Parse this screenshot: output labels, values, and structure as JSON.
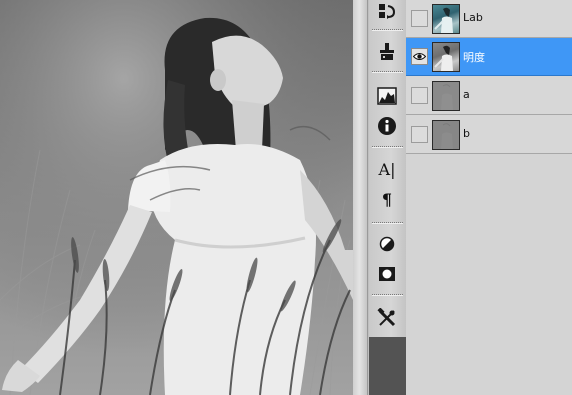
{
  "colors": {
    "panel_bg": "#d7d7d7",
    "selected_row": "#3f97f6",
    "toolstrip_bg": "#535353"
  },
  "canvas": {
    "image_subject": "grayscale-photo-woman-in-grass-field"
  },
  "toolbar": {
    "tools": [
      {
        "name": "history-icon"
      },
      {
        "name": "brush-presets-icon"
      },
      {
        "name": "histogram-icon"
      },
      {
        "name": "info-icon"
      },
      {
        "name": "character-icon",
        "glyph": "A|"
      },
      {
        "name": "paragraph-icon",
        "glyph": "¶"
      },
      {
        "name": "adjustments-icon"
      },
      {
        "name": "masks-icon"
      },
      {
        "name": "tool-presets-icon"
      }
    ]
  },
  "channels": {
    "items": [
      {
        "label": "Lab",
        "visible": false,
        "selected": false,
        "thumb": "color"
      },
      {
        "label": "明度",
        "visible": true,
        "selected": true,
        "thumb": "gray"
      },
      {
        "label": "a",
        "visible": false,
        "selected": false,
        "thumb": "flat"
      },
      {
        "label": "b",
        "visible": false,
        "selected": false,
        "thumb": "flat"
      }
    ]
  }
}
